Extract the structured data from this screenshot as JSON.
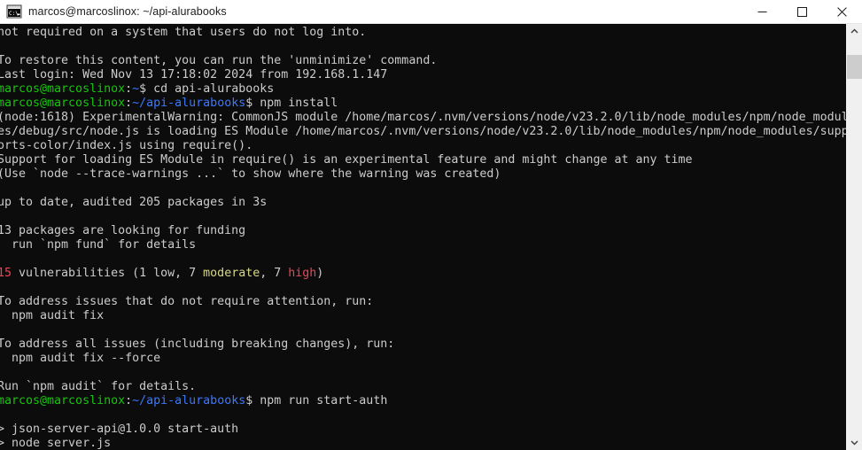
{
  "window": {
    "title": "marcos@marcoslinox: ~/api-alurabooks",
    "icon": "terminal-icon",
    "minimize_label": "—",
    "maximize_label": "□",
    "close_label": "✕"
  },
  "theme": {
    "background": "#0c0c0c",
    "foreground": "#cccccc",
    "green": "#16c60c",
    "blue": "#3b78ff",
    "red": "#e74856",
    "yellow": "#d7d787",
    "titlebar_bg": "#ffffff",
    "titlebar_fg": "#1c1c1c",
    "scrollbar_bg": "#f0f0f0",
    "scrollbar_thumb": "#cdcdcd"
  },
  "scrollbar": {
    "up_arrow": "∧",
    "down_arrow": "∨",
    "thumb_position_pct": 4,
    "thumb_size_pct": 6
  },
  "terminal": {
    "prompt_user": "marcos@marcoslinox",
    "prompt_sep": ":",
    "prompt_symbol": "$",
    "lines": [
      {
        "segments": [
          {
            "text": "not required on a system that users do not log into.",
            "color": "white"
          }
        ]
      },
      {
        "segments": [
          {
            "text": "",
            "color": "white"
          }
        ]
      },
      {
        "segments": [
          {
            "text": "To restore this content, you can run the 'unminimize' command.",
            "color": "white"
          }
        ]
      },
      {
        "segments": [
          {
            "text": "Last login: Wed Nov 13 17:18:02 2024 from 192.168.1.147",
            "color": "white"
          }
        ]
      },
      {
        "segments": [
          {
            "text": "marcos@marcoslinox",
            "color": "green"
          },
          {
            "text": ":",
            "color": "white"
          },
          {
            "text": "~",
            "color": "blue"
          },
          {
            "text": "$ cd api-alurabooks",
            "color": "white"
          }
        ]
      },
      {
        "segments": [
          {
            "text": "marcos@marcoslinox",
            "color": "green"
          },
          {
            "text": ":",
            "color": "white"
          },
          {
            "text": "~/api-alurabooks",
            "color": "blue"
          },
          {
            "text": "$ npm install",
            "color": "white"
          }
        ]
      },
      {
        "segments": [
          {
            "text": "(node:1618) ExperimentalWarning: CommonJS module /home/marcos/.nvm/versions/node/v23.2.0/lib/node_modules/npm/node_modul",
            "color": "white"
          }
        ]
      },
      {
        "segments": [
          {
            "text": "es/debug/src/node.js is loading ES Module /home/marcos/.nvm/versions/node/v23.2.0/lib/node_modules/npm/node_modules/supp",
            "color": "white"
          }
        ]
      },
      {
        "segments": [
          {
            "text": "orts-color/index.js using require().",
            "color": "white"
          }
        ]
      },
      {
        "segments": [
          {
            "text": "Support for loading ES Module in require() is an experimental feature and might change at any time",
            "color": "white"
          }
        ]
      },
      {
        "segments": [
          {
            "text": "(Use `node --trace-warnings ...` to show where the warning was created)",
            "color": "white"
          }
        ]
      },
      {
        "segments": [
          {
            "text": "",
            "color": "white"
          }
        ]
      },
      {
        "segments": [
          {
            "text": "up to date, audited 205 packages in 3s",
            "color": "white"
          }
        ]
      },
      {
        "segments": [
          {
            "text": "",
            "color": "white"
          }
        ]
      },
      {
        "segments": [
          {
            "text": "13 packages are looking for funding",
            "color": "white"
          }
        ]
      },
      {
        "segments": [
          {
            "text": "  run `npm fund` for details",
            "color": "white"
          }
        ]
      },
      {
        "segments": [
          {
            "text": "",
            "color": "white"
          }
        ]
      },
      {
        "segments": [
          {
            "text": "15",
            "color": "red"
          },
          {
            "text": " vulnerabilities (1 low, 7 ",
            "color": "white"
          },
          {
            "text": "moderate",
            "color": "yellow"
          },
          {
            "text": ", 7 ",
            "color": "white"
          },
          {
            "text": "high",
            "color": "red"
          },
          {
            "text": ")",
            "color": "white"
          }
        ]
      },
      {
        "segments": [
          {
            "text": "",
            "color": "white"
          }
        ]
      },
      {
        "segments": [
          {
            "text": "To address issues that do not require attention, run:",
            "color": "white"
          }
        ]
      },
      {
        "segments": [
          {
            "text": "  npm audit fix",
            "color": "white"
          }
        ]
      },
      {
        "segments": [
          {
            "text": "",
            "color": "white"
          }
        ]
      },
      {
        "segments": [
          {
            "text": "To address all issues (including breaking changes), run:",
            "color": "white"
          }
        ]
      },
      {
        "segments": [
          {
            "text": "  npm audit fix --force",
            "color": "white"
          }
        ]
      },
      {
        "segments": [
          {
            "text": "",
            "color": "white"
          }
        ]
      },
      {
        "segments": [
          {
            "text": "Run `npm audit` for details.",
            "color": "white"
          }
        ]
      },
      {
        "segments": [
          {
            "text": "marcos@marcoslinox",
            "color": "green"
          },
          {
            "text": ":",
            "color": "white"
          },
          {
            "text": "~/api-alurabooks",
            "color": "blue"
          },
          {
            "text": "$ npm run start-auth",
            "color": "white"
          }
        ]
      },
      {
        "segments": [
          {
            "text": "",
            "color": "white"
          }
        ]
      },
      {
        "segments": [
          {
            "text": "> json-server-api@1.0.0 start-auth",
            "color": "white"
          }
        ]
      },
      {
        "segments": [
          {
            "text": "> node server.js",
            "color": "white"
          }
        ]
      }
    ]
  }
}
